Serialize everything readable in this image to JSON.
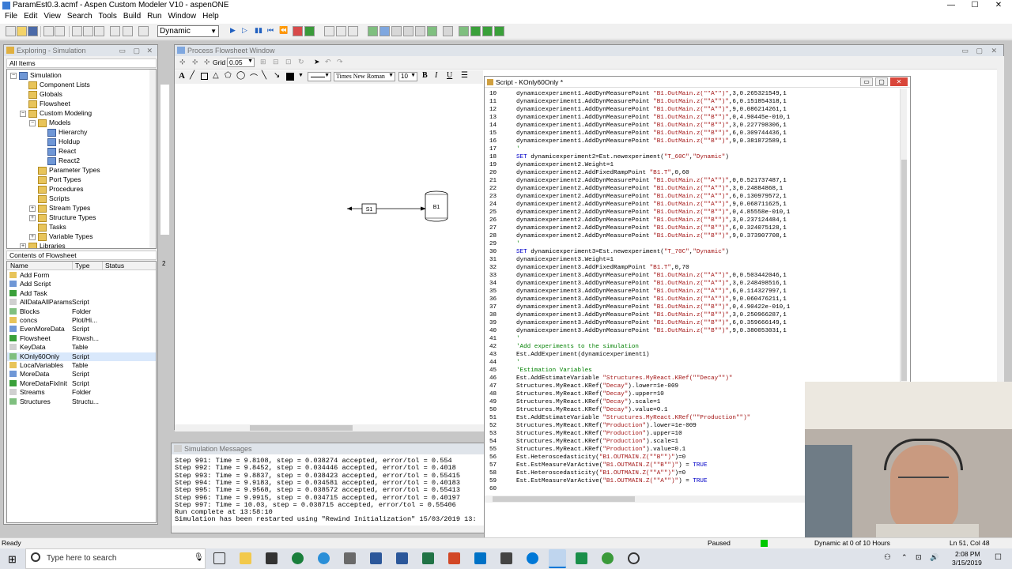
{
  "window": {
    "title": "ParamEst0.3.acmf - Aspen Custom Modeler V10 - aspenONE",
    "minimize": "—",
    "maximize": "☐",
    "close": "✕"
  },
  "menu": [
    "File",
    "Edit",
    "View",
    "Search",
    "Tools",
    "Build",
    "Run",
    "Window",
    "Help"
  ],
  "toolbar": {
    "run_mode": "Dynamic"
  },
  "explorer": {
    "title": "Exploring - Simulation",
    "filter": "All Items",
    "tree": [
      {
        "label": "Simulation",
        "level": 0,
        "icon": "simulation-icon",
        "expander": "−"
      },
      {
        "label": "Component Lists",
        "level": 1,
        "icon": "folder-icon",
        "expander": ""
      },
      {
        "label": "Globals",
        "level": 1,
        "icon": "folder-icon",
        "expander": ""
      },
      {
        "label": "Flowsheet",
        "level": 1,
        "icon": "folder-icon",
        "expander": ""
      },
      {
        "label": "Custom Modeling",
        "level": 1,
        "icon": "folder-icon",
        "expander": "−"
      },
      {
        "label": "Models",
        "level": 2,
        "icon": "folder-icon",
        "expander": "−"
      },
      {
        "label": "Hierarchy",
        "level": 3,
        "icon": "model-icon",
        "expander": ""
      },
      {
        "label": "Holdup",
        "level": 3,
        "icon": "model-icon",
        "expander": ""
      },
      {
        "label": "React",
        "level": 3,
        "icon": "model-icon",
        "expander": ""
      },
      {
        "label": "React2",
        "level": 3,
        "icon": "model-icon",
        "expander": ""
      },
      {
        "label": "Parameter Types",
        "level": 2,
        "icon": "folder-icon",
        "expander": ""
      },
      {
        "label": "Port Types",
        "level": 2,
        "icon": "folder-icon",
        "expander": ""
      },
      {
        "label": "Procedures",
        "level": 2,
        "icon": "folder-icon",
        "expander": ""
      },
      {
        "label": "Scripts",
        "level": 2,
        "icon": "folder-icon",
        "expander": ""
      },
      {
        "label": "Stream Types",
        "level": 2,
        "icon": "folder-icon",
        "expander": "+"
      },
      {
        "label": "Structure Types",
        "level": 2,
        "icon": "folder-icon",
        "expander": "+"
      },
      {
        "label": "Tasks",
        "level": 2,
        "icon": "folder-icon",
        "expander": ""
      },
      {
        "label": "Variable Types",
        "level": 2,
        "icon": "folder-icon",
        "expander": "+"
      },
      {
        "label": "Libraries",
        "level": 1,
        "icon": "folder-icon",
        "expander": "+"
      }
    ]
  },
  "contents": {
    "title": "Contents of Flowsheet",
    "headers": {
      "name": "Name",
      "type": "Type",
      "status": "Status"
    },
    "rows": [
      {
        "name": "Add Form",
        "type": ""
      },
      {
        "name": "Add Script",
        "type": ""
      },
      {
        "name": "Add Task",
        "type": ""
      },
      {
        "name": "AllDataAllParams",
        "type": "Script"
      },
      {
        "name": "Blocks",
        "type": "Folder"
      },
      {
        "name": "concs",
        "type": "Plot/Hi..."
      },
      {
        "name": "EvenMoreData",
        "type": "Script"
      },
      {
        "name": "Flowsheet",
        "type": "Flowsh..."
      },
      {
        "name": "KeyData",
        "type": "Table"
      },
      {
        "name": "KOnly60Only",
        "type": "Script"
      },
      {
        "name": "LocalVariables",
        "type": "Table"
      },
      {
        "name": "MoreData",
        "type": "Script"
      },
      {
        "name": "MoreDataFixInit",
        "type": "Script"
      },
      {
        "name": "Streams",
        "type": "Folder"
      },
      {
        "name": "Structures",
        "type": "Structu..."
      }
    ]
  },
  "flowsheet": {
    "title": "Process Flowsheet Window",
    "grid_label": "Grid",
    "grid_value": "0.05",
    "font": "Times New Roman",
    "font_size": "10",
    "bold": "B",
    "italic": "I",
    "underline": "U",
    "stream_label": "S1",
    "block_label": "B1",
    "side_number": "2"
  },
  "messages": {
    "title": "Simulation Messages",
    "lines": [
      "Step 991: Time = 9.8108, step = 0.038274 accepted, error/tol = 0.554",
      "Step 992: Time = 9.8452, step = 0.034446 accepted, error/tol = 0.4018",
      "Step 993: Time = 9.8837, step = 0.038423 accepted, error/tol = 0.55415",
      "Step 994: Time = 9.9183, step = 0.034581 accepted, error/tol = 0.40183",
      "Step 995: Time = 9.9568, step = 0.038572 accepted, error/tol = 0.55413",
      "Step 996: Time = 9.9915, step = 0.034715 accepted, error/tol = 0.40197",
      "Step 997: Time = 10.03, step = 0.038715 accepted, error/tol = 0.55406",
      "Run complete at 13:58:10",
      "Simulation has been restarted using \"Rewind Initialization\" 15/03/2019 13:"
    ]
  },
  "script": {
    "title": "Script - KOnly60Only *",
    "lines": [
      {
        "n": "10",
        "t": "dynamicexperiment1.AddDynMeasurePoint \"B1.OutMain.z(\"\"A\"\")\",3,0.265321549,1",
        "k": "code"
      },
      {
        "n": "11",
        "t": "dynamicexperiment1.AddDynMeasurePoint \"B1.OutMain.z(\"\"A\"\")\",6,0.151854318,1",
        "k": "code"
      },
      {
        "n": "12",
        "t": "dynamicexperiment1.AddDynMeasurePoint \"B1.OutMain.z(\"\"A\"\")\",9,0.086214261,1",
        "k": "code"
      },
      {
        "n": "13",
        "t": "dynamicexperiment1.AddDynMeasurePoint \"B1.OutMain.z(\"\"B\"\")\",0,4.90445e-010,1",
        "k": "code"
      },
      {
        "n": "14",
        "t": "dynamicexperiment1.AddDynMeasurePoint \"B1.OutMain.z(\"\"B\"\")\",3,0.227798306,1",
        "k": "code"
      },
      {
        "n": "15",
        "t": "dynamicexperiment1.AddDynMeasurePoint \"B1.OutMain.z(\"\"B\"\")\",6,0.309744436,1",
        "k": "code"
      },
      {
        "n": "16",
        "t": "dynamicexperiment1.AddDynMeasurePoint \"B1.OutMain.z(\"\"B\"\")\",9,0.381872589,1",
        "k": "code"
      },
      {
        "n": "17",
        "t": "'",
        "k": "cmt"
      },
      {
        "n": "18",
        "t": "SET dynamicexperiment2=Est.newexperiment(\"T_60C\",\"Dynamic\")",
        "k": "code"
      },
      {
        "n": "19",
        "t": "dynamicexperiment2.Weight=1",
        "k": "code"
      },
      {
        "n": "20",
        "t": "dynamicexperiment2.AddFixedRampPoint \"B1.T\",0,60",
        "k": "code"
      },
      {
        "n": "21",
        "t": "dynamicexperiment2.AddDynMeasurePoint \"B1.OutMain.z(\"\"A\"\")\",0,0.521737487,1",
        "k": "code"
      },
      {
        "n": "22",
        "t": "dynamicexperiment2.AddDynMeasurePoint \"B1.OutMain.z(\"\"A\"\")\",3,0.24884868,1",
        "k": "code"
      },
      {
        "n": "23",
        "t": "dynamicexperiment2.AddDynMeasurePoint \"B1.OutMain.z(\"\"A\"\")\",6,0.130979572,1",
        "k": "code"
      },
      {
        "n": "24",
        "t": "dynamicexperiment2.AddDynMeasurePoint \"B1.OutMain.z(\"\"A\"\")\",9,0.068711625,1",
        "k": "code"
      },
      {
        "n": "25",
        "t": "dynamicexperiment2.AddDynMeasurePoint \"B1.OutMain.z(\"\"B\"\")\",0,4.85558e-010,1",
        "k": "code"
      },
      {
        "n": "26",
        "t": "dynamicexperiment2.AddDynMeasurePoint \"B1.OutMain.z(\"\"B\"\")\",3,0.237124484,1",
        "k": "code"
      },
      {
        "n": "27",
        "t": "dynamicexperiment2.AddDynMeasurePoint \"B1.OutMain.z(\"\"B\"\")\",6,0.324075128,1",
        "k": "code"
      },
      {
        "n": "28",
        "t": "dynamicexperiment2.AddDynMeasurePoint \"B1.OutMain.z(\"\"B\"\")\",9,0.373907708,1",
        "k": "code"
      },
      {
        "n": "29",
        "t": "'",
        "k": "cmt"
      },
      {
        "n": "30",
        "t": "SET dynamicexperiment3=Est.newexperiment(\"T_70C\",\"Dynamic\")",
        "k": "code"
      },
      {
        "n": "31",
        "t": "dynamicexperiment3.Weight=1",
        "k": "code"
      },
      {
        "n": "32",
        "t": "dynamicexperiment3.AddFixedRampPoint \"B1.T\",0,70",
        "k": "code"
      },
      {
        "n": "33",
        "t": "dynamicexperiment3.AddDynMeasurePoint \"B1.OutMain.z(\"\"A\"\")\",0,0.503442046,1",
        "k": "code"
      },
      {
        "n": "34",
        "t": "dynamicexperiment3.AddDynMeasurePoint \"B1.OutMain.z(\"\"A\"\")\",3,0.248498516,1",
        "k": "code"
      },
      {
        "n": "35",
        "t": "dynamicexperiment3.AddDynMeasurePoint \"B1.OutMain.z(\"\"A\"\")\",6,0.114327997,1",
        "k": "code"
      },
      {
        "n": "36",
        "t": "dynamicexperiment3.AddDynMeasurePoint \"B1.OutMain.z(\"\"A\"\")\",9,0.060476211,1",
        "k": "code"
      },
      {
        "n": "37",
        "t": "dynamicexperiment3.AddDynMeasurePoint \"B1.OutMain.z(\"\"B\"\")\",0,4.90422e-010,1",
        "k": "code"
      },
      {
        "n": "38",
        "t": "dynamicexperiment3.AddDynMeasurePoint \"B1.OutMain.z(\"\"B\"\")\",3,0.250966287,1",
        "k": "code"
      },
      {
        "n": "39",
        "t": "dynamicexperiment3.AddDynMeasurePoint \"B1.OutMain.z(\"\"B\"\")\",6,0.359666149,1",
        "k": "code"
      },
      {
        "n": "40",
        "t": "dynamicexperiment3.AddDynMeasurePoint \"B1.OutMain.z(\"\"B\"\")\",9,0.380053031,1",
        "k": "code"
      },
      {
        "n": "41",
        "t": "'",
        "k": "cmt"
      },
      {
        "n": "42",
        "t": "'Add experiments to the simulation",
        "k": "cmt"
      },
      {
        "n": "43",
        "t": "Est.AddExperiment(dynamicexperiment1)",
        "k": "code"
      },
      {
        "n": "44",
        "t": "'",
        "k": "cmt"
      },
      {
        "n": "45",
        "t": "'Estimation Variables",
        "k": "cmt"
      },
      {
        "n": "46",
        "t": "Est.AddEstimateVariable \"Structures.MyReact.KRef(\"\"Decay\"\")\"",
        "k": "code"
      },
      {
        "n": "47",
        "t": "Structures.MyReact.KRef(\"Decay\").lower=1e-009",
        "k": "code"
      },
      {
        "n": "48",
        "t": "Structures.MyReact.KRef(\"Decay\").upper=10",
        "k": "code"
      },
      {
        "n": "49",
        "t": "Structures.MyReact.KRef(\"Decay\").scale=1",
        "k": "code"
      },
      {
        "n": "50",
        "t": "Structures.MyReact.KRef(\"Decay\").value=0.1",
        "k": "code"
      },
      {
        "n": "51",
        "t": "Est.AddEstimateVariable \"Structures.MyReact.KRef(\"\"Production\"\")\"",
        "k": "code"
      },
      {
        "n": "52",
        "t": "Structures.MyReact.KRef(\"Production\").lower=1e-009",
        "k": "code"
      },
      {
        "n": "53",
        "t": "Structures.MyReact.KRef(\"Production\").upper=10",
        "k": "code"
      },
      {
        "n": "54",
        "t": "Structures.MyReact.KRef(\"Production\").scale=1",
        "k": "code"
      },
      {
        "n": "55",
        "t": "Structures.MyReact.KRef(\"Production\").value=0.1",
        "k": "code"
      },
      {
        "n": "56",
        "t": "Est.Heteroscedasticity(\"B1.OUTMAIN.Z(\"\"B\"\")\")=0",
        "k": "code"
      },
      {
        "n": "57",
        "t": "Est.EstMeasureVarActive(\"B1.OUTMAIN.Z(\"\"B\"\")\") = TRUE",
        "k": "code"
      },
      {
        "n": "58",
        "t": "Est.Heteroscedasticity(\"B1.OUTMAIN.Z(\"\"A\"\")\")=0",
        "k": "code"
      },
      {
        "n": "59",
        "t": "Est.EstMeasureVarActive(\"B1.OUTMAIN.Z(\"\"A\"\")\") = TRUE",
        "k": "code"
      },
      {
        "n": "60",
        "t": "",
        "k": "code"
      }
    ]
  },
  "statusbar": {
    "left": "Ready",
    "run_state": "Paused",
    "progress": "Dynamic at 0 of 10 Hours",
    "cursor": "Ln 51, Col 48"
  },
  "taskbar": {
    "search_placeholder": "Type here to search",
    "time": "2:08 PM",
    "date": "3/15/2019"
  },
  "colors": {
    "accent": "#0078d7",
    "keyword": "#0000c8",
    "string": "#a31515",
    "comment": "#008000",
    "run_ok": "#00c800"
  }
}
